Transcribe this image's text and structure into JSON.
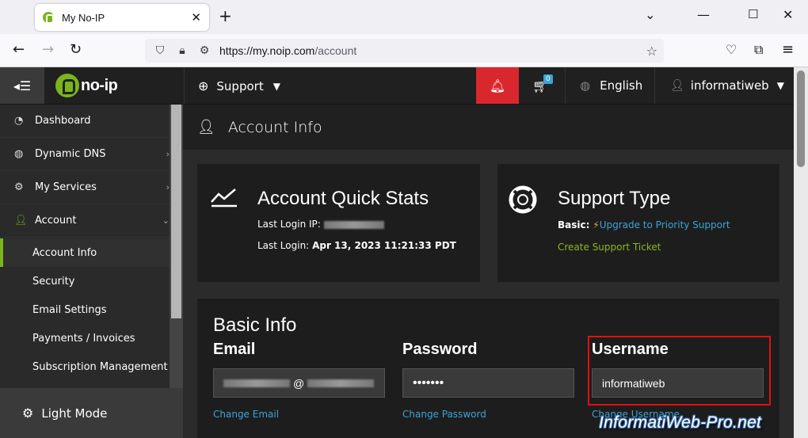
{
  "browser": {
    "tab_title": "My No-IP",
    "tab_close": "✕",
    "new_tab": "+",
    "url_host": "https://my.noip.com",
    "url_path": "/account"
  },
  "header": {
    "logo_text": "no-ip",
    "support_label": "Support",
    "cart_count": "0",
    "language": "English",
    "username": "informatiweb"
  },
  "sidebar": {
    "items": [
      {
        "label": "Dashboard",
        "icon": "dashboard-icon"
      },
      {
        "label": "Dynamic DNS",
        "icon": "globe-icon"
      },
      {
        "label": "My Services",
        "icon": "gear-icon"
      },
      {
        "label": "Account",
        "icon": "user-icon"
      }
    ],
    "account_sub": [
      {
        "label": "Account Info",
        "active": true
      },
      {
        "label": "Security"
      },
      {
        "label": "Email Settings"
      },
      {
        "label": "Payments / Invoices"
      },
      {
        "label": "Subscription Management"
      }
    ],
    "light_mode": "Light Mode"
  },
  "page": {
    "title": "Account Info"
  },
  "quick_stats": {
    "title": "Account Quick Stats",
    "last_login_ip_label": "Last Login IP:",
    "last_login_label": "Last Login:",
    "last_login_value": "Apr 13, 2023 11:21:33 PDT"
  },
  "support_type": {
    "title": "Support Type",
    "basic_label": "Basic:",
    "upgrade_link": "Upgrade to Priority Support",
    "create_ticket": "Create Support Ticket"
  },
  "basic_info": {
    "title": "Basic Info",
    "email_label": "Email",
    "email_at": "@",
    "email_link": "Change Email",
    "password_label": "Password",
    "password_value": "•••••••",
    "password_link": "Change Password",
    "username_label": "Username",
    "username_value": "informatiweb",
    "username_link": "Change Username"
  },
  "watermark": "InformatiWeb-Pro.net",
  "colors": {
    "accent_green": "#7ab51d",
    "alert_red": "#d9272e",
    "link_blue": "#3ba4d8",
    "highlight_red": "#e01010"
  }
}
